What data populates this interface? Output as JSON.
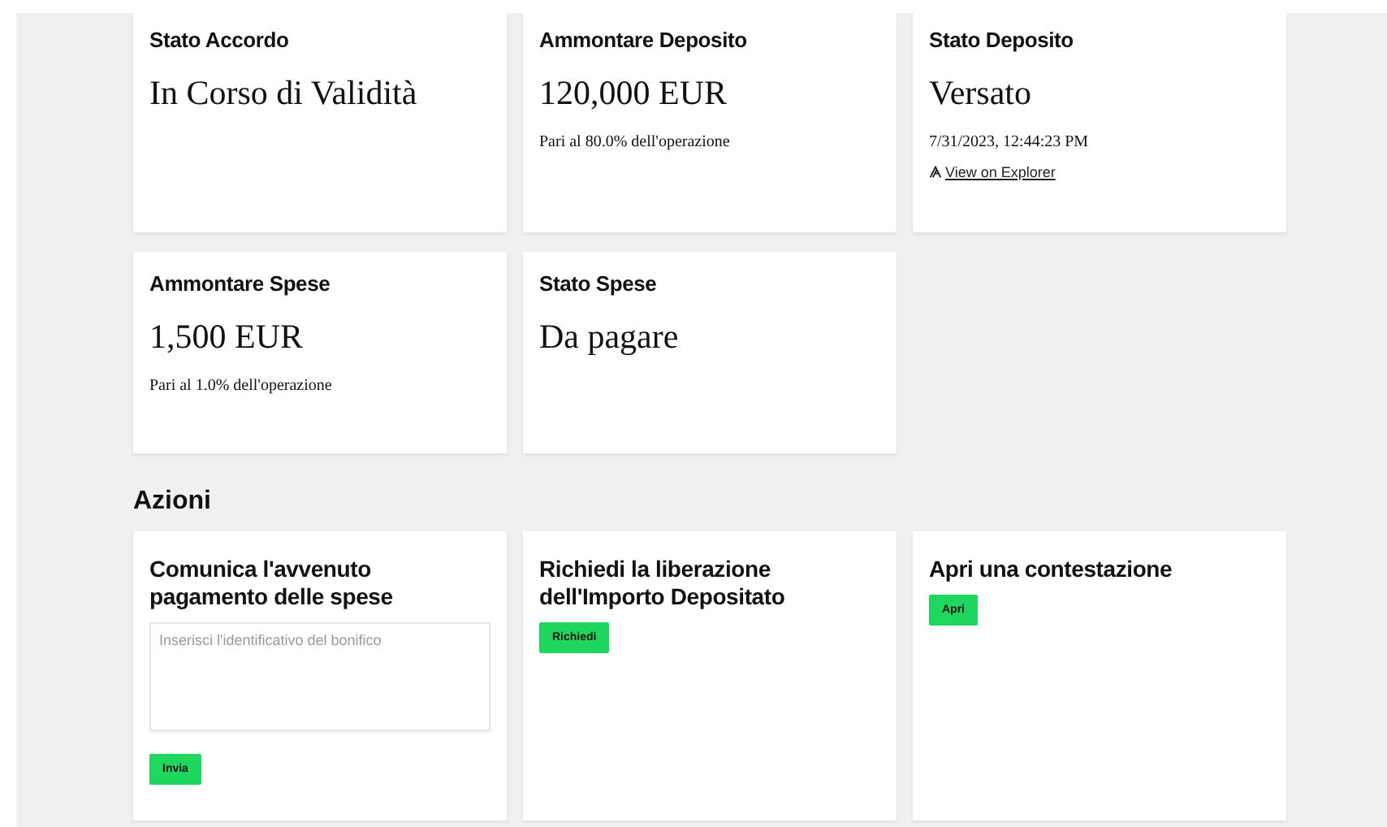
{
  "stats": [
    {
      "title": "Stato Accordo",
      "value": "In Corso di Validità"
    },
    {
      "title": "Ammontare Deposito",
      "value": "120,000 EUR",
      "note": "Pari al 80.0% dell'operazione"
    },
    {
      "title": "Stato Deposito",
      "value": "Versato",
      "note": "7/31/2023, 12:44:23 PM",
      "link": "View on Explorer"
    },
    {
      "title": "Ammontare Spese",
      "value": "1,500 EUR",
      "note": "Pari al 1.0% dell'operazione"
    },
    {
      "title": "Stato Spese",
      "value": "Da pagare"
    }
  ],
  "actions_heading": "Azioni",
  "actions": [
    {
      "title": "Comunica l'avvenuto pagamento delle spese",
      "placeholder": "Inserisci l'identificativo del bonifico",
      "button": "Invia"
    },
    {
      "title": "Richiedi la liberazione dell'Importo Depositato",
      "button": "Richiedi"
    },
    {
      "title": "Apri una contestazione",
      "button": "Apri"
    }
  ]
}
